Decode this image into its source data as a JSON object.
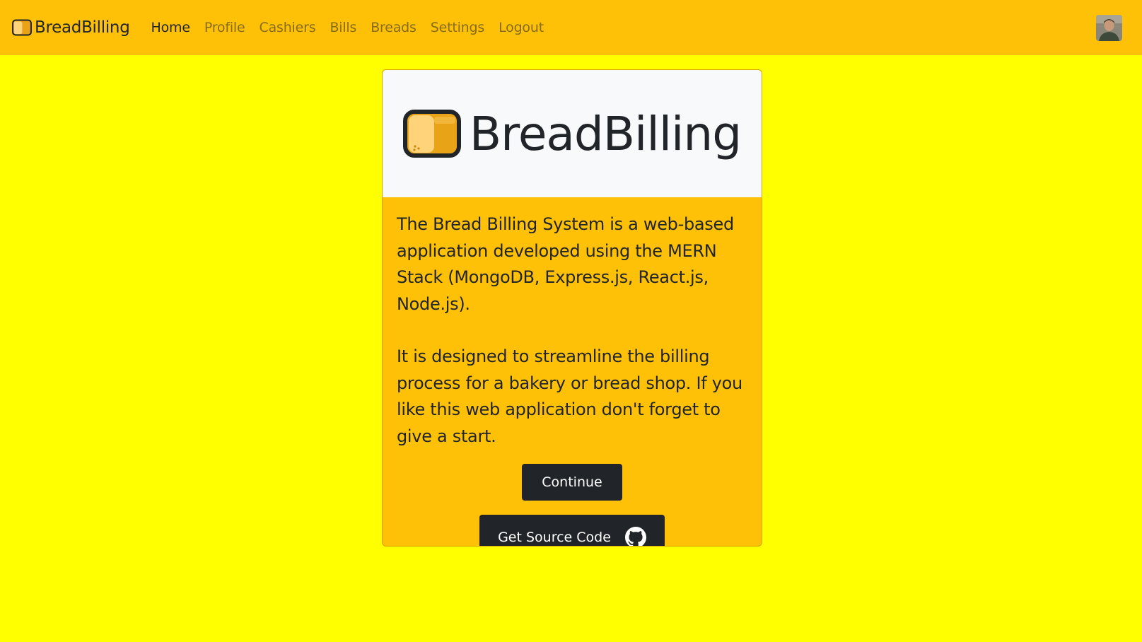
{
  "navbar": {
    "brand": "BreadBilling",
    "links": [
      {
        "label": "Home",
        "active": true
      },
      {
        "label": "Profile",
        "active": false
      },
      {
        "label": "Cashiers",
        "active": false
      },
      {
        "label": "Bills",
        "active": false
      },
      {
        "label": "Breads",
        "active": false
      },
      {
        "label": "Settings",
        "active": false
      },
      {
        "label": "Logout",
        "active": false
      }
    ],
    "avatar_icon": "user-avatar"
  },
  "card": {
    "title": "BreadBilling",
    "logo_icon": "bread-icon",
    "paragraphs": [
      "The Bread Billing System is a web-based application developed using the MERN Stack (MongoDB, Express.js, React.js, Node.js).",
      "It is designed to streamline the billing process for a bakery or bread shop. If you like this web application don't forget to give a start."
    ],
    "continue_label": "Continue",
    "source_label": "Get Source Code",
    "source_icon": "github-icon"
  },
  "colors": {
    "page_bg": "#ffff00",
    "navbar_bg": "#ffc107",
    "card_body_bg": "#ffc107",
    "card_header_bg": "#f8f9fa",
    "button_bg": "#212529"
  }
}
